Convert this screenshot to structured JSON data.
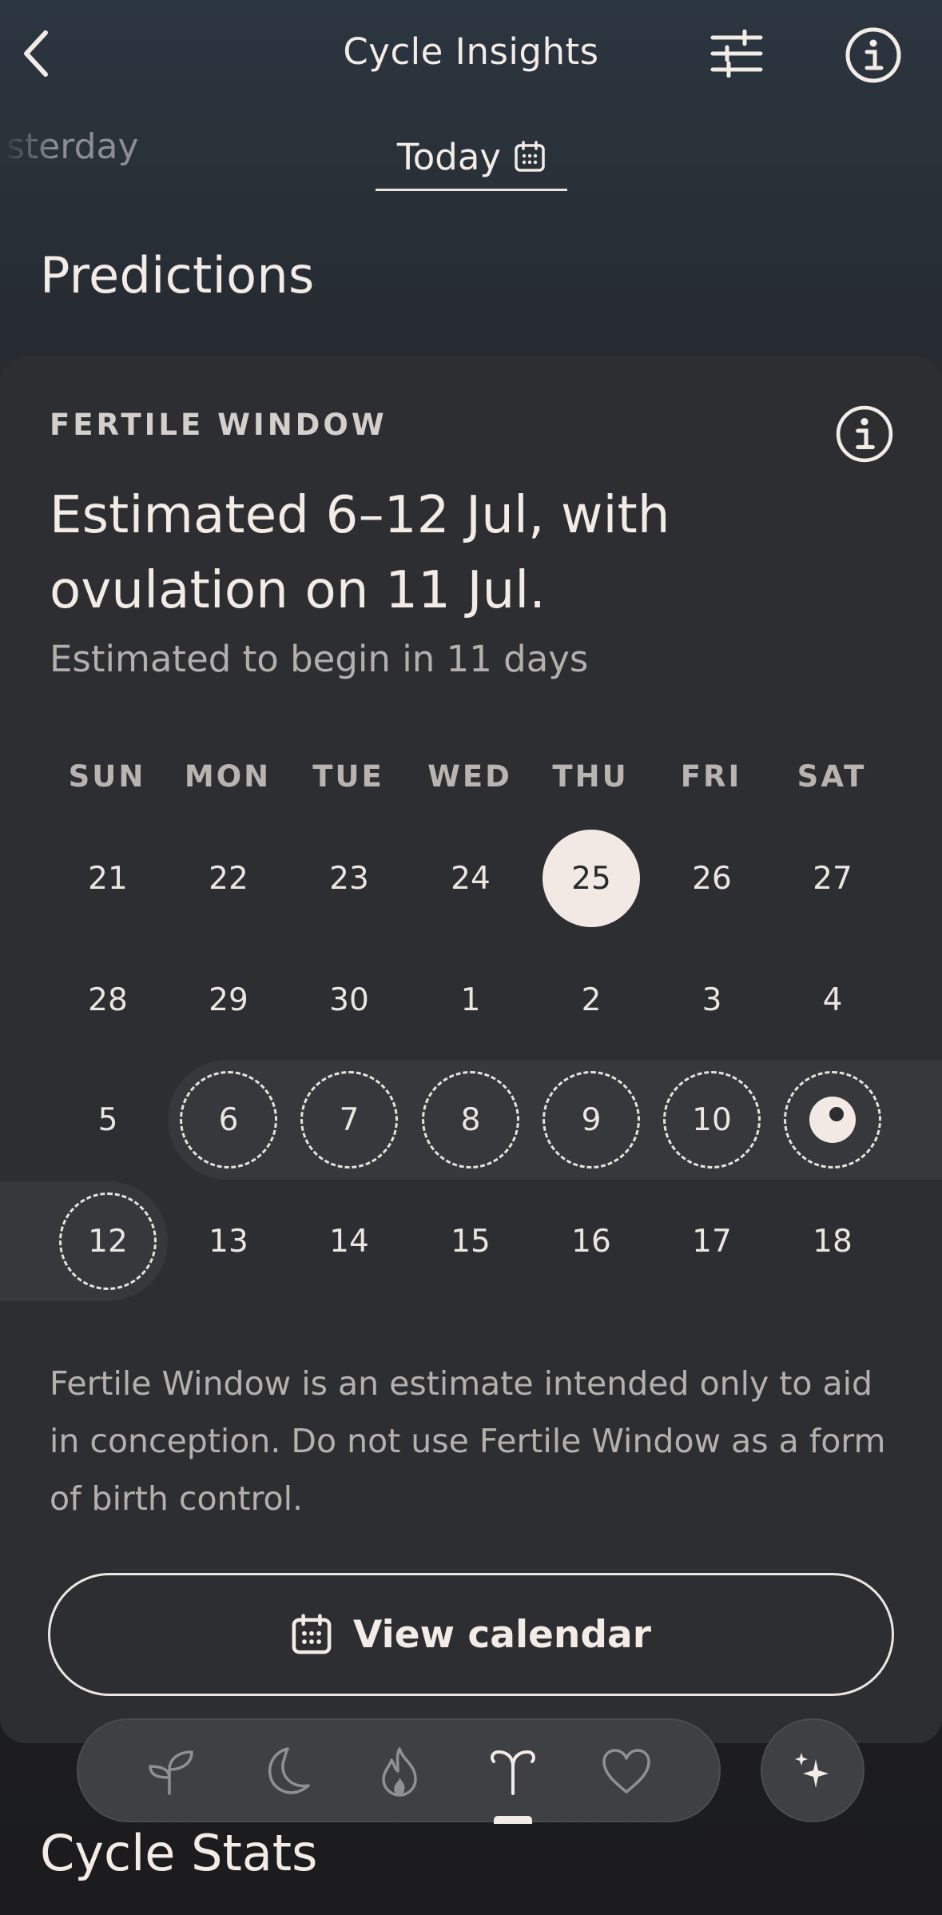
{
  "header": {
    "title": "Cycle Insights",
    "back_icon": "chevron-left-icon",
    "filter_icon": "sliders-icon",
    "info_icon": "info-icon"
  },
  "tabs": [
    {
      "label": "Yesterday",
      "visible_text": "sterday",
      "selected": false
    },
    {
      "label": "Today",
      "icon": "calendar-icon",
      "selected": true
    }
  ],
  "predictions": {
    "section_title": "Predictions",
    "card": {
      "label": "FERTILE WINDOW",
      "headline": "Estimated 6–12 Jul, with ovulation on 11 Jul.",
      "subtext": "Estimated to begin in 11 days",
      "calendar": {
        "weekdays": [
          "SUN",
          "MON",
          "TUE",
          "WED",
          "THU",
          "FRI",
          "SAT"
        ],
        "weeks": [
          [
            "21",
            "22",
            "23",
            "24",
            "25",
            "26",
            "27"
          ],
          [
            "28",
            "29",
            "30",
            "1",
            "2",
            "3",
            "4"
          ],
          [
            "5",
            "6",
            "7",
            "8",
            "9",
            "10",
            ""
          ],
          [
            "12",
            "13",
            "14",
            "15",
            "16",
            "17",
            "18"
          ]
        ],
        "today": "25",
        "fertile_days": [
          "6",
          "7",
          "8",
          "9",
          "10",
          "12"
        ],
        "ovulation_day": "11"
      },
      "disclaimer": "Fertile Window is an estimate intended only to aid in conception. Do not use Fertile Window as a form of birth control.",
      "view_calendar_label": "View calendar"
    }
  },
  "bottom_nav": {
    "items": [
      {
        "icon": "sprout-icon",
        "active": false
      },
      {
        "icon": "moon-icon",
        "active": false
      },
      {
        "icon": "flame-icon",
        "active": false
      },
      {
        "icon": "ovary-icon",
        "active": true
      },
      {
        "icon": "heart-icon",
        "active": false
      }
    ],
    "ai_button_icon": "sparkles-icon"
  },
  "next_section_title": "Cycle Stats",
  "colors": {
    "accent": "#f3e9e4",
    "card_bg": "#2d2e31",
    "text": "#f2ebe6"
  }
}
